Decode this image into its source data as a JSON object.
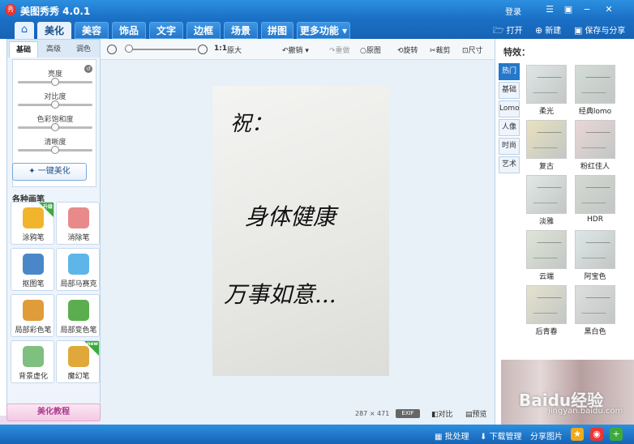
{
  "app": {
    "title": "美图秀秀 4.0.1",
    "logo_text": "秀",
    "login": "登录"
  },
  "window_controls": {
    "menu_icon": "☰",
    "skin_icon": "▣",
    "min": "−",
    "close": "✕"
  },
  "nav": {
    "home_icon": "⌂",
    "tabs": [
      "美化",
      "美容",
      "饰品",
      "文字",
      "边框",
      "场景",
      "拼图",
      "更多功能 ▾"
    ],
    "active_tab": "美化",
    "open": "打开",
    "new": "新建",
    "save_share": "保存与分享"
  },
  "left": {
    "subtabs": [
      "基础",
      "高级",
      "调色"
    ],
    "active_subtab": "基础",
    "sliders": [
      {
        "label": "亮度",
        "value": 0.5
      },
      {
        "label": "对比度",
        "value": 0.5
      },
      {
        "label": "色彩饱和度",
        "value": 0.5
      },
      {
        "label": "清晰度",
        "value": 0.5
      }
    ],
    "one_key": "一键美化",
    "brushes_title": "各种画笔",
    "brushes": [
      {
        "label": "涂鸦笔",
        "badge": "升级",
        "color": "#f0b52c"
      },
      {
        "label": "消除笔",
        "badge": "",
        "color": "#e98a8a"
      },
      {
        "label": "抠图笔",
        "badge": "",
        "color": "#4a87c9"
      },
      {
        "label": "局部马赛克",
        "badge": "",
        "color": "#5db5e8"
      },
      {
        "label": "局部彩色笔",
        "badge": "",
        "color": "#e09c3a"
      },
      {
        "label": "局部变色笔",
        "badge": "",
        "color": "#5bae4e"
      },
      {
        "label": "背景虚化",
        "badge": "",
        "color": "#7fbf7f"
      },
      {
        "label": "魔幻笔",
        "badge": "new",
        "color": "#e0a83a"
      }
    ],
    "tutorial": "美化教程"
  },
  "toolbar": {
    "ratio": "1:1",
    "original_size": "原大",
    "undo": "撤销",
    "redo": "重做",
    "original": "原图",
    "rotate": "旋转",
    "crop": "裁剪",
    "size": "尺寸"
  },
  "canvas": {
    "handwriting": [
      "祝：",
      "身体健康",
      "万事如意..."
    ],
    "dimensions": "287 × 471",
    "exif": "EXIF",
    "compare": "对比",
    "preview": "预览"
  },
  "effects": {
    "title": "特效：",
    "categories": [
      "热门",
      "基础",
      "Lomo",
      "人像",
      "时尚",
      "艺术"
    ],
    "active_category": "热门",
    "items": [
      "柔光",
      "经典lomo",
      "复古",
      "粉红佳人",
      "淡雅",
      "HDR",
      "云端",
      "阿宝色",
      "后青春",
      "黑白色"
    ],
    "tints": [
      "#dfe6e6",
      "#d3dcd6",
      "#e9e1bf",
      "#ead6d6",
      "#e2e8e6",
      "#d5d8d2",
      "#e0e5d8",
      "#dde6e8",
      "#e5e2ce",
      "#dedede"
    ]
  },
  "statusbar": {
    "batch": "批处理",
    "download": "下载管理",
    "share": "分享图片"
  },
  "watermark": {
    "text": "Baidu经验",
    "url": "jingyan.baidu.com"
  }
}
